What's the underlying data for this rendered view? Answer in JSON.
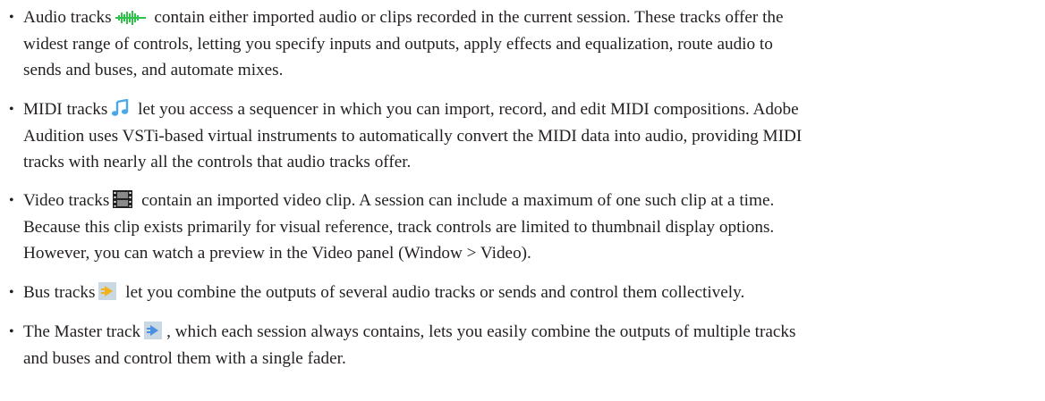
{
  "items": [
    {
      "icon": "audio-track-waveform-icon",
      "lines": [
        [
          "Audio tracks",
          " contain either imported audio or clips recorded in the current session. These tracks offer the"
        ],
        [
          "widest range of controls, letting you specify inputs and outputs, apply effects and equalization, route audio to"
        ],
        [
          "sends and buses, and automate mixes."
        ]
      ]
    },
    {
      "icon": "midi-track-note-icon",
      "lines": [
        [
          "MIDI tracks",
          " let you access a sequencer in which you can import, record, and edit MIDI compositions. Adobe"
        ],
        [
          "Audition uses VSTi-based virtual instruments to automatically convert the MIDI data into audio, providing MIDI"
        ],
        [
          "tracks with nearly all the controls that audio tracks offer."
        ]
      ]
    },
    {
      "icon": "video-track-film-icon",
      "lines": [
        [
          "Video tracks",
          " contain an imported video clip. A session can include a maximum of one such clip at a time."
        ],
        [
          "Because this clip exists primarily for visual reference, track controls are limited to thumbnail display options."
        ],
        [
          "However, you can watch a preview in the Video panel (Window > Video)."
        ]
      ]
    },
    {
      "icon": "bus-track-icon",
      "lines": [
        [
          "Bus tracks",
          " let you combine the outputs of several audio tracks or sends and control them collectively."
        ]
      ]
    },
    {
      "icon": "master-track-icon",
      "lines": [
        [
          "The Master track",
          ", which each session always contains, lets you easily combine the outputs of multiple tracks"
        ],
        [
          "and buses and control them with a single fader."
        ]
      ]
    }
  ],
  "bullet": "•",
  "colors": {
    "text": "#231f20",
    "audio_icon": "#2ec44a",
    "midi_icon": "#4aa8e8",
    "video_icon": "#222222",
    "bus_icon": "#f2b21c",
    "master_icon": "#4a8fe0"
  }
}
